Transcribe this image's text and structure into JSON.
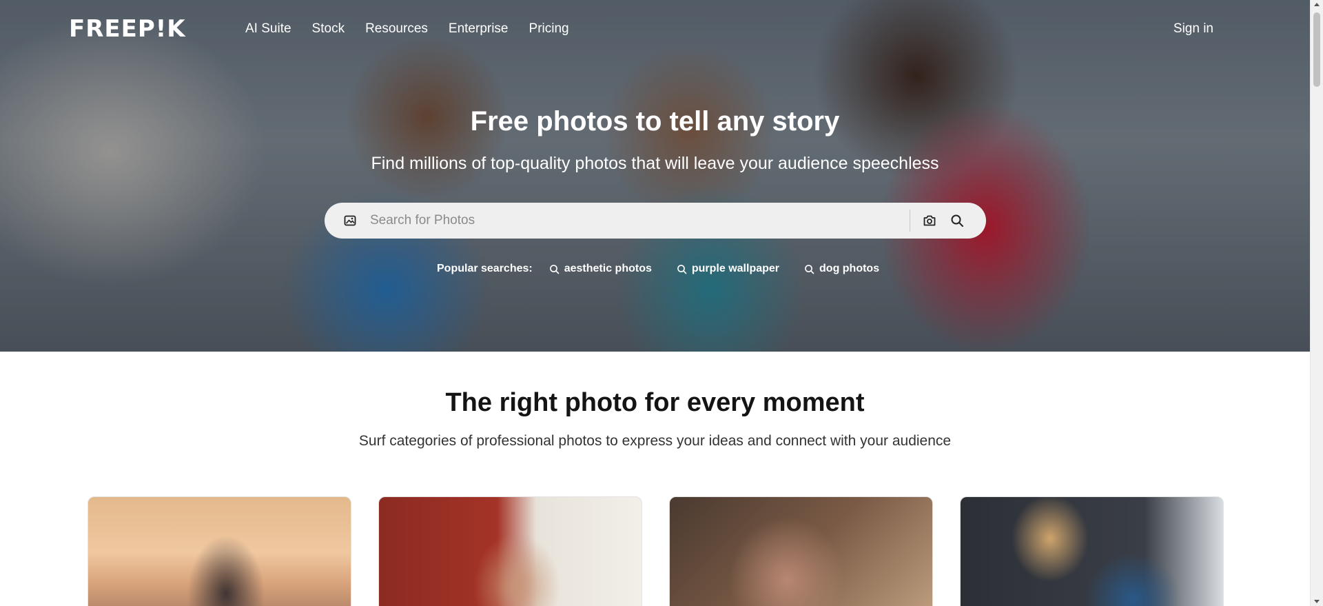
{
  "header": {
    "logo": "FREEP!K",
    "nav": [
      "AI Suite",
      "Stock",
      "Resources",
      "Enterprise",
      "Pricing"
    ],
    "signin": "Sign in"
  },
  "hero": {
    "title": "Free photos to tell any story",
    "subtitle": "Find millions of top-quality photos that will leave your audience speechless",
    "search": {
      "placeholder": "Search for Photos",
      "type_icon": "image-icon",
      "camera_icon": "camera-icon",
      "search_icon": "search-icon"
    },
    "popular_label": "Popular searches:",
    "popular": [
      "aesthetic photos",
      "purple wallpaper",
      "dog photos"
    ]
  },
  "section": {
    "title": "The right photo for every moment",
    "subtitle": "Surf categories of professional photos to express your ideas and connect with your audience"
  },
  "colors": {
    "search_bg": "#efefef",
    "text_dark": "#141414",
    "white": "#ffffff"
  }
}
